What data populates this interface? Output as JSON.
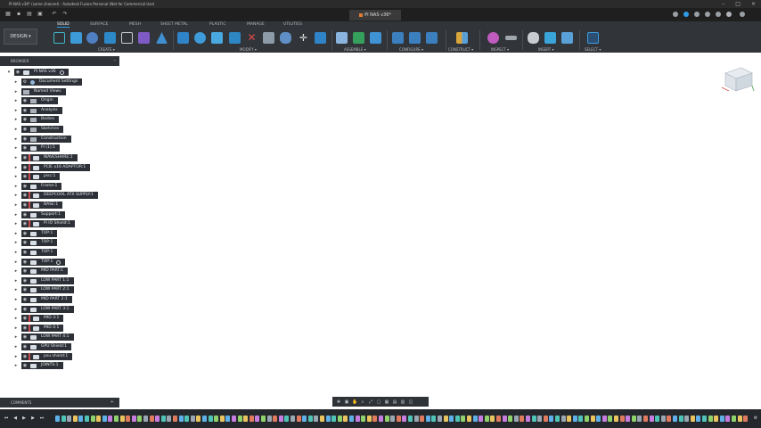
{
  "app": {
    "window_title": "PI NAS v36* (some channel) - Autodesk Fusion Personal (Not for Commercial Use)",
    "document_tab": "PI NAS v36*"
  },
  "ribbon": {
    "workspace_button": "DESIGN ▾",
    "tabs": [
      "SOLID",
      "SURFACE",
      "MESH",
      "SHEET METAL",
      "PLASTIC",
      "MANAGE",
      "UTILITIES"
    ],
    "active_tab": "SOLID",
    "groups": [
      "CREATE ▾",
      "MODIFY ▾",
      "ASSEMBLE ▾",
      "CONFIGURE ▾",
      "CONSTRUCT ▾",
      "INSPECT ▾",
      "INSERT ▾",
      "SELECT ▾"
    ]
  },
  "browser": {
    "header": "BROWSER",
    "root": "PI NAS v36",
    "items": [
      {
        "label": "Document Settings",
        "icon": "gear-icon"
      },
      {
        "label": "Named Views",
        "icon": "folder-icon"
      },
      {
        "label": "Origin",
        "icon": "folder-icon"
      },
      {
        "label": "Analysis",
        "icon": "folder-icon"
      },
      {
        "label": "Bodies",
        "icon": "folder-icon"
      },
      {
        "label": "Sketches",
        "icon": "folder-icon"
      },
      {
        "label": "Construction",
        "icon": "folder-icon"
      },
      {
        "label": "Pi (1):1",
        "icon": "component-icon"
      },
      {
        "label": "WAVESHARE:1",
        "icon": "component-icon"
      },
      {
        "label": "PCIE x16 ADAPTOR:1",
        "icon": "component-icon"
      },
      {
        "label": "pisc:1",
        "icon": "component-icon"
      },
      {
        "label": "Frame:1",
        "icon": "component-icon"
      },
      {
        "label": "DEEPCOOL ATX SUPPLY:1",
        "icon": "component-icon"
      },
      {
        "label": "BASE:1",
        "icon": "component-icon"
      },
      {
        "label": "Support:1",
        "icon": "component-icon"
      },
      {
        "label": "Pi IO Shield:1",
        "icon": "component-icon"
      },
      {
        "label": "TOP:1",
        "icon": "component-icon"
      },
      {
        "label": "TOP:1",
        "icon": "component-icon"
      },
      {
        "label": "TOP:1",
        "icon": "component-icon"
      },
      {
        "label": "TOP:1",
        "icon": "component-icon"
      },
      {
        "label": "MID PART:1",
        "icon": "component-icon"
      },
      {
        "label": "LOW PART 1:1",
        "icon": "component-icon"
      },
      {
        "label": "LOW PART 2:1",
        "icon": "component-icon"
      },
      {
        "label": "MID PART 2:1",
        "icon": "component-icon"
      },
      {
        "label": "LOW PART 3:1",
        "icon": "component-icon"
      },
      {
        "label": "MID 3:1",
        "icon": "component-icon"
      },
      {
        "label": "MID 4:1",
        "icon": "component-icon"
      },
      {
        "label": "LOW PART 4:1",
        "icon": "component-icon"
      },
      {
        "label": "GPU Shield:1",
        "icon": "component-icon"
      },
      {
        "label": "psu shield:1",
        "icon": "component-icon"
      },
      {
        "label": "JOINTS:1",
        "icon": "component-icon"
      }
    ]
  },
  "comments": {
    "label": "COMMENTS"
  },
  "colors": {
    "accent": "#2e9be6",
    "panel": "#2d3137",
    "ribbon": "#313438",
    "timeline": "#24272b"
  }
}
